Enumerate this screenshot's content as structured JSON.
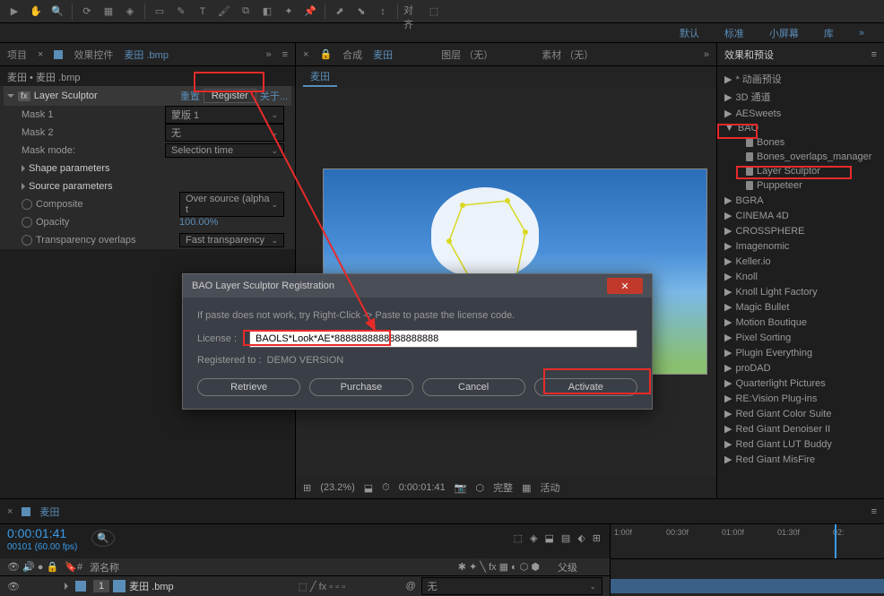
{
  "workspace_tabs": [
    "默认",
    "标准",
    "小屏幕",
    "库"
  ],
  "left_panel": {
    "tabs": {
      "project": "项目",
      "effects": "效果控件",
      "file": "麦田 .bmp"
    },
    "breadcrumb": "麦田 • 麦田 .bmp",
    "effect": {
      "name": "Layer Sculptor",
      "reset": "重置",
      "register": "Register",
      "about": "关于...",
      "props": {
        "mask1_label": "Mask 1",
        "mask1_val": "蒙版 1",
        "mask2_label": "Mask 2",
        "mask2_val": "无",
        "maskmode_label": "Mask mode:",
        "maskmode_val": "Selection time",
        "shape_label": "Shape parameters",
        "source_label": "Source parameters",
        "composite_label": "Composite",
        "composite_val": "Over source (alpha t",
        "opacity_label": "Opacity",
        "opacity_val": "100.00%",
        "transparency_label": "Transparency overlaps",
        "transparency_val": "Fast transparency"
      }
    }
  },
  "center_panel": {
    "tabs": {
      "comp": "合成",
      "name": "麦田",
      "layers": "图层 （无）",
      "footage": "素材 （无）"
    },
    "subtab": "麦田",
    "status": {
      "zoom": "(23.2%)",
      "time": "0:00:01:41",
      "quality": "完整",
      "render": "活动"
    }
  },
  "right_panel": {
    "title": "效果和预设",
    "items": [
      {
        "t": "* 动画预设",
        "l": 0
      },
      {
        "t": "3D 通道",
        "l": 0
      },
      {
        "t": "AESweets",
        "l": 0
      },
      {
        "t": "BAO",
        "l": 0,
        "open": true
      },
      {
        "t": "Bones",
        "l": 2,
        "lock": true
      },
      {
        "t": "Bones_overlaps_manager",
        "l": 2,
        "lock": true
      },
      {
        "t": "Layer Sculptor",
        "l": 2,
        "lock": true
      },
      {
        "t": "Puppeteer",
        "l": 2,
        "lock": true
      },
      {
        "t": "BGRA",
        "l": 0
      },
      {
        "t": "CINEMA 4D",
        "l": 0
      },
      {
        "t": "CROSSPHERE",
        "l": 0
      },
      {
        "t": "Imagenomic",
        "l": 0
      },
      {
        "t": "Keller.io",
        "l": 0
      },
      {
        "t": "Knoll",
        "l": 0
      },
      {
        "t": "Knoll Light Factory",
        "l": 0
      },
      {
        "t": "Magic Bullet",
        "l": 0
      },
      {
        "t": "Motion Boutique",
        "l": 0
      },
      {
        "t": "Pixel Sorting",
        "l": 0
      },
      {
        "t": "Plugin Everything",
        "l": 0
      },
      {
        "t": "proDAD",
        "l": 0
      },
      {
        "t": "Quarterlight Pictures",
        "l": 0
      },
      {
        "t": "RE:Vision Plug-ins",
        "l": 0
      },
      {
        "t": "Red Giant Color Suite",
        "l": 0
      },
      {
        "t": "Red Giant Denoiser II",
        "l": 0
      },
      {
        "t": "Red Giant LUT Buddy",
        "l": 0
      },
      {
        "t": "Red Giant MisFire",
        "l": 0
      }
    ]
  },
  "timeline": {
    "tab": "麦田",
    "timecode": "0:00:01:41",
    "fps": "00101 (60.00 fps)",
    "cols": {
      "source": "源名称",
      "parent": "父级"
    },
    "layer": {
      "num": "1",
      "name": "麦田 .bmp",
      "parent": "无"
    },
    "ticks": [
      "1:00f",
      "00:30f",
      "01:00f",
      "01:30f",
      "02:"
    ]
  },
  "dialog": {
    "title": "BAO Layer Sculptor Registration",
    "hint": "If paste does not work, try Right-Click -> Paste to paste the license code.",
    "license_label": "License :",
    "license_val": "BAOLS*Look*AE*8888888888888888888",
    "reg_label": "Registered to :",
    "reg_val": "DEMO VERSION",
    "btns": {
      "retrieve": "Retrieve",
      "purchase": "Purchase",
      "cancel": "Cancel",
      "activate": "Activate"
    }
  }
}
